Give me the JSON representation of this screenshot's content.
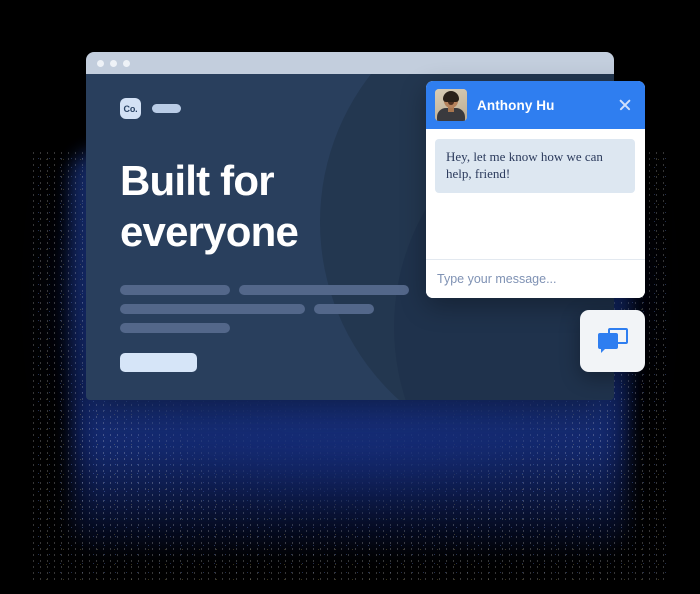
{
  "browser": {
    "window_dots": [
      "dot-red",
      "dot-yellow",
      "dot-green"
    ],
    "logo_text": "Co.",
    "nav_pill_label": "",
    "nav_pill_right_label": ""
  },
  "hero": {
    "headline": "Built for everyone",
    "cta_label": "",
    "skeleton_rows": [
      [
        110,
        170
      ],
      [
        185,
        60
      ],
      [
        110
      ]
    ]
  },
  "chat": {
    "agent_name": "Anthony Hu",
    "avatar_alt": "Anthony Hu profile photo",
    "close_label": "",
    "messages": [
      {
        "from": "agent",
        "text": "Hey, let me know how we can help, friend!"
      }
    ],
    "input_placeholder": "Type your message...",
    "input_value": ""
  },
  "launcher": {
    "label": "",
    "icon": "chat-bubbles-icon"
  },
  "colors": {
    "accent_blue": "#2f7ef0",
    "hero_navy": "#293f5d",
    "hero_arc_navy": "#233750",
    "titlebar_gray": "#c3cedd",
    "skeleton_bar": "#53678a",
    "cta_light": "#d6e5f8",
    "bubble_bg": "#dde7f1",
    "bubble_text": "#2b3a5c",
    "placeholder_text": "#7f92b4",
    "launcher_bg": "#f2f4f7",
    "page_bg": "#000000",
    "glow_blue": "#1a3a8c"
  }
}
